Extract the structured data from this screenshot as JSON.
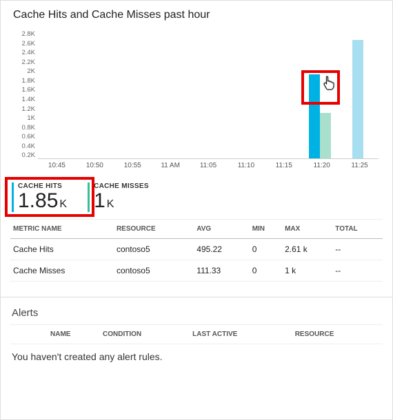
{
  "chart": {
    "title": "Cache Hits and Cache Misses past hour"
  },
  "chart_data": {
    "type": "bar",
    "title": "Cache Hits and Cache Misses past hour",
    "xlabel": "",
    "ylabel": "",
    "ylim": [
      0,
      2800
    ],
    "y_ticks": [
      "2.8K",
      "2.6K",
      "2.4K",
      "2.2K",
      "2K",
      "1.8K",
      "1.6K",
      "1.4K",
      "1.2K",
      "1K",
      "0.8K",
      "0.6K",
      "0.4K",
      "0.2K"
    ],
    "categories": [
      "10:45",
      "10:50",
      "10:55",
      "11 AM",
      "11:05",
      "11:10",
      "11:15",
      "11:20",
      "11:25"
    ],
    "series": [
      {
        "name": "Cache Hits",
        "color": "#00b2e4",
        "values": [
          0,
          0,
          0,
          0,
          0,
          0,
          0,
          1850,
          2600
        ]
      },
      {
        "name": "Cache Misses",
        "color": "#a8e0cd",
        "values": [
          0,
          0,
          0,
          0,
          0,
          0,
          0,
          1000,
          null
        ]
      }
    ]
  },
  "kpi": {
    "hits": {
      "label": "CACHE HITS",
      "value": "1.85",
      "unit": "K"
    },
    "misses": {
      "label": "CACHE MISSES",
      "value": "1",
      "unit": "K"
    }
  },
  "metrics_table": {
    "headers": {
      "name": "METRIC NAME",
      "resource": "RESOURCE",
      "avg": "AVG",
      "min": "MIN",
      "max": "MAX",
      "total": "TOTAL"
    },
    "rows": [
      {
        "name": "Cache Hits",
        "resource": "contoso5",
        "avg": "495.22",
        "min": "0",
        "max": "2.61 k",
        "total": "--"
      },
      {
        "name": "Cache Misses",
        "resource": "contoso5",
        "avg": "111.33",
        "min": "0",
        "max": "1 k",
        "total": "--"
      }
    ]
  },
  "alerts": {
    "title": "Alerts",
    "headers": {
      "name": "NAME",
      "condition": "CONDITION",
      "last_active": "LAST ACTIVE",
      "resource": "RESOURCE"
    },
    "empty": "You haven't created any alert rules."
  }
}
